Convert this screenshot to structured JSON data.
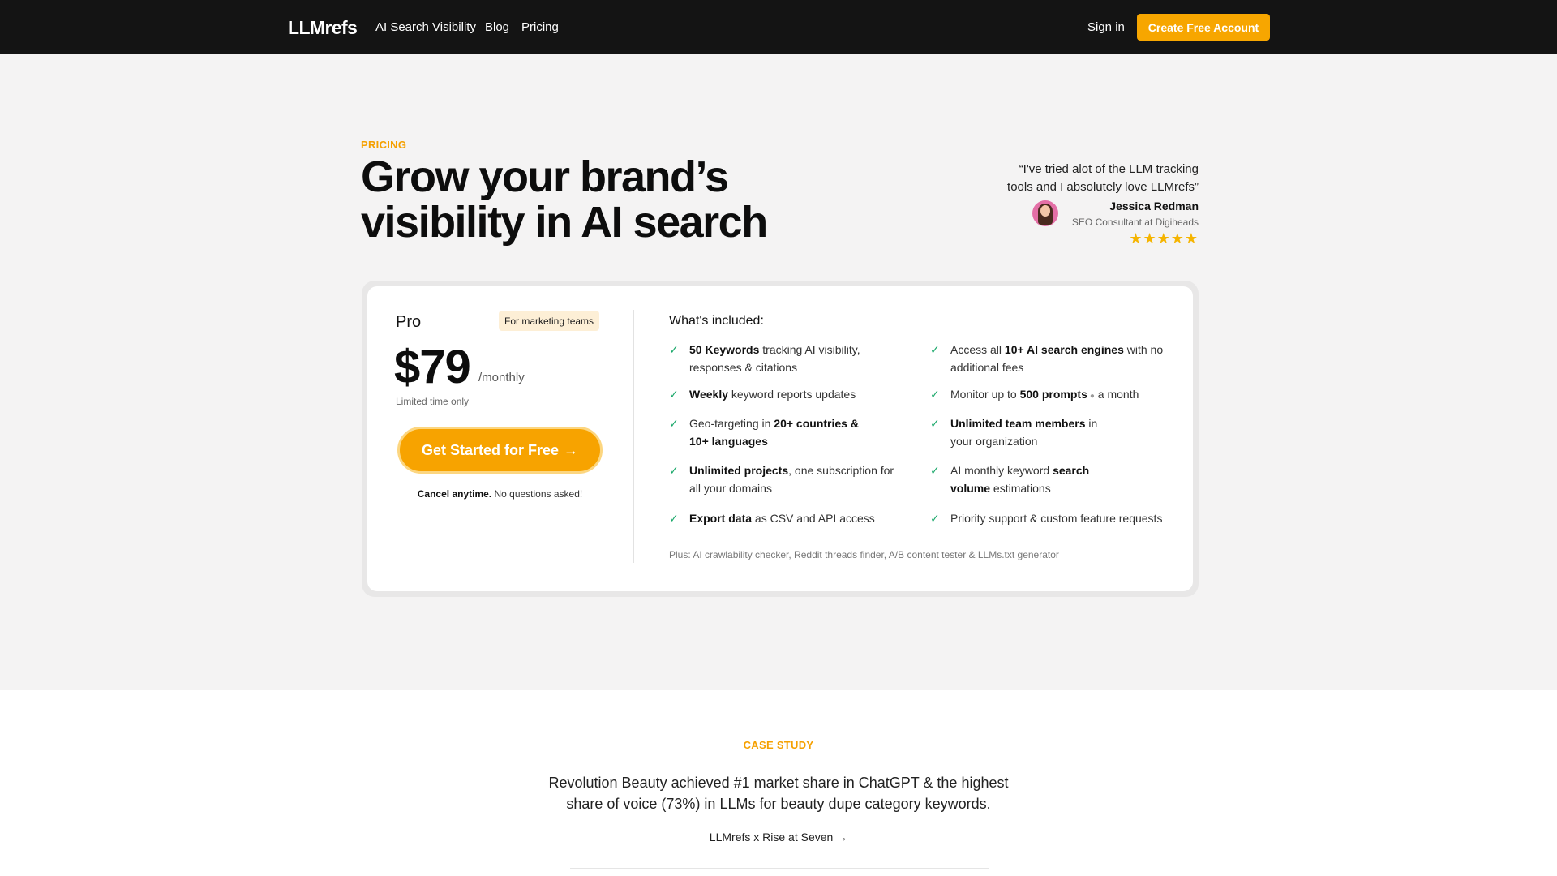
{
  "nav": {
    "logo": "LLMrefs",
    "links": [
      "AI Search Visibility",
      "Blog",
      "Pricing"
    ],
    "signin": "Sign in",
    "cta": "Create Free Account"
  },
  "hero": {
    "eyebrow": "PRICING",
    "headline_line1": "Grow your brand’s",
    "headline_line2": "visibility in AI search"
  },
  "testimonial": {
    "quote_line1": "“I've tried alot of the LLM tracking",
    "quote_line2": "tools and I absolutely love LLMrefs”",
    "name": "Jessica Redman",
    "role": "SEO Consultant at Digiheads",
    "stars": "★★★★★",
    "rating": 5
  },
  "plan": {
    "name": "Pro",
    "badge": "For marketing teams",
    "price": "$79",
    "period": "/monthly",
    "note": "Limited time only",
    "button": "Get Started for Free",
    "button_arrow": "→",
    "cancel_bold": "Cancel anytime.",
    "cancel_rest": " No questions asked!"
  },
  "included": {
    "title": "What's included:",
    "f1_b": "50 Keywords",
    "f1_r": " tracking AI visibility,",
    "f1_l2": "responses & citations",
    "f2_b": "Weekly",
    "f2_r": " keyword reports updates",
    "f3_a": "Geo-targeting in ",
    "f3_b": "20+ countries &",
    "f3_l2": "10+ languages",
    "f4_b": "Unlimited projects",
    "f4_r": ", one subscription for",
    "f4_l2": "all your domains",
    "f5_b": "Export data",
    "f5_r": " as CSV and API access",
    "f6_a": "Access all ",
    "f6_b": "10+ AI search engines",
    "f6_r": " with no",
    "f6_l2": "additional fees",
    "f7_a": "Monitor up to ",
    "f7_b": "500 prompts",
    "f7_r": " a month",
    "f8_b": "Unlimited team members",
    "f8_r": " in",
    "f8_l2": "your organization",
    "f9_a": "AI monthly keyword ",
    "f9_b": "search",
    "f9_l2b": "volume",
    "f9_l2r": " estimations",
    "f10": "Priority support & custom feature requests",
    "plus": "Plus: AI crawlability checker, Reddit threads finder, A/B content tester & LLMs.txt generator"
  },
  "case_study": {
    "eyebrow": "CASE STUDY",
    "line1": "Revolution Beauty achieved #1 market share in ChatGPT & the highest",
    "line2": "share of voice (73%) in LLMs for beauty dupe category keywords.",
    "link": "LLMrefs x Rise at Seven →"
  },
  "colors": {
    "accent": "#f7a600",
    "nav_bg": "#141414",
    "check": "#1aa86a",
    "star": "#f5b400"
  }
}
